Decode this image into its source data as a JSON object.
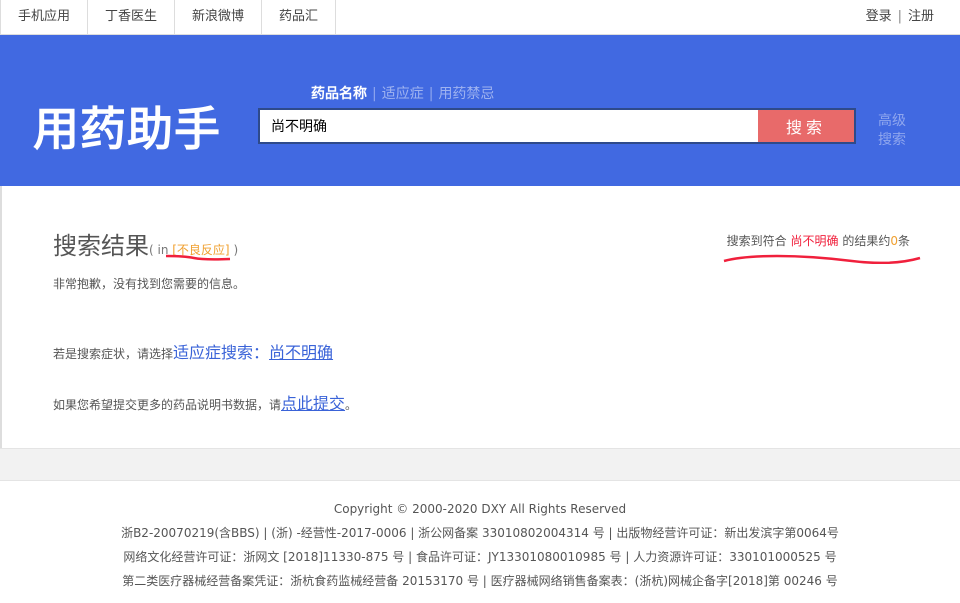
{
  "topbar": {
    "links": [
      "手机应用",
      "丁香医生",
      "新浪微博",
      "药品汇"
    ],
    "login": "登录",
    "sep": "|",
    "register": "注册"
  },
  "header": {
    "logo": "用药助手",
    "tabs": [
      "药品名称",
      "适应症",
      "用药禁忌"
    ],
    "tab_sep": "|",
    "search_value": "尚不明确",
    "search_button": "搜索",
    "advanced": "高级搜索"
  },
  "result": {
    "title": "搜索结果",
    "in_open": "( in ",
    "category": "[不良反应]",
    "in_close": " )",
    "count_prefix": "搜索到符合 ",
    "keyword": "尚不明确",
    "count_mid": " 的结果约",
    "count": "0",
    "count_suffix": "条",
    "sorry": "非常抱歉，没有找到您需要的信息。",
    "symptom_prefix": "若是搜索症状，请选择",
    "symptom_link": "适应症搜索：",
    "symptom_keyword": "尚不明确",
    "submit_prefix": "如果您希望提交更多的药品说明书数据，请",
    "submit_link": "点此提交",
    "submit_suffix": "。"
  },
  "footer": {
    "lines": [
      "Copyright © 2000-2020 DXY All Rights Reserved",
      "浙B2-20070219(含BBS) | (浙) -经营性-2017-0006 | 浙公网备案 33010802004314 号 | 出版物经营许可证：新出发滨字第0064号",
      "网络文化经营许可证：浙网文 [2018]11330-875 号 | 食品许可证：JY13301080010985 号 | 人力资源许可证：330101000525 号",
      "第二类医疗器械经营备案凭证：浙杭食药监械经营备 20153170 号 | 医疗器械网络销售备案表：(浙杭)网械企备字[2018]第 00246 号"
    ]
  },
  "colors": {
    "brand": "#4169e1",
    "search_button": "#e86a6a",
    "annotation": "#f0203c"
  }
}
